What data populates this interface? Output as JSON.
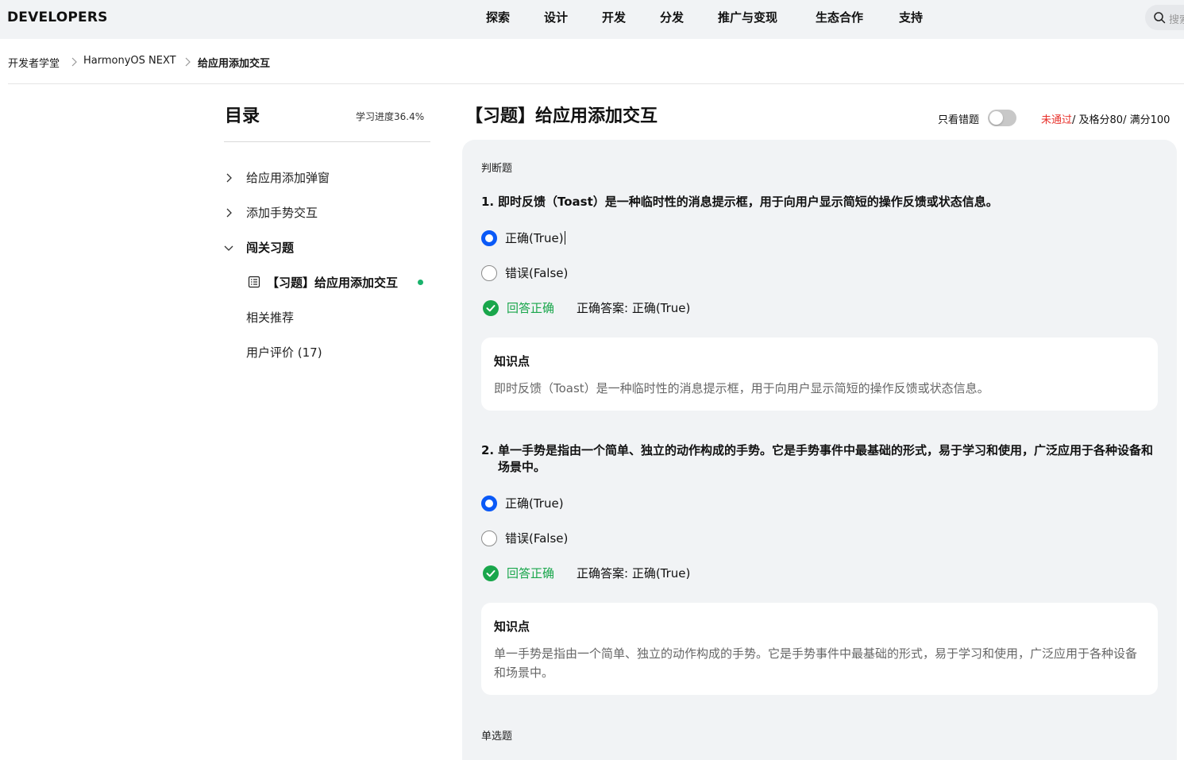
{
  "brand": "DEVELOPERS",
  "nav": {
    "items": [
      {
        "label": "探索"
      },
      {
        "label": "设计"
      },
      {
        "label": "开发"
      },
      {
        "label": "分发"
      },
      {
        "label": "推广与变现"
      },
      {
        "label": "生态合作"
      },
      {
        "label": "支持"
      }
    ],
    "search_placeholder": "搜索"
  },
  "breadcrumb": [
    {
      "label": "开发者学堂"
    },
    {
      "label": "HarmonyOS NEXT"
    },
    {
      "label": "给应用添加交互"
    }
  ],
  "toc": {
    "title": "目录",
    "progress": "学习进度36.4%",
    "items": [
      {
        "label": "给应用添加弹窗"
      },
      {
        "label": "添加手势交互"
      },
      {
        "label": "闯关习题"
      },
      {
        "label": "【习题】给应用添加交互"
      },
      {
        "label": "相关推荐"
      },
      {
        "label": "用户评价 (17)"
      }
    ]
  },
  "main": {
    "title": "【习题】给应用添加交互",
    "wrong_only_label": "只看错题",
    "wrong_only_enabled": false,
    "score": {
      "status": "未通过",
      "rest": "/ 及格分80/ 满分100"
    },
    "sections": [
      {
        "label": "判断题"
      },
      {
        "label": "单选题"
      }
    ],
    "questions": [
      {
        "number": "1.",
        "text": "即时反馈（Toast）是一种临时性的消息提示框，用于向用户显示简短的操作反馈或状态信息。",
        "options": [
          {
            "label": "正确(True)",
            "selected": true
          },
          {
            "label": "错误(False)",
            "selected": false
          }
        ],
        "result_status": "回答正确",
        "correct_answer": "正确答案:  正确(True)",
        "knowledge_title": "知识点",
        "knowledge_text": "即时反馈（Toast）是一种临时性的消息提示框，用于向用户显示简短的操作反馈或状态信息。"
      },
      {
        "number": "2.",
        "text": "单一手势是指由一个简单、独立的动作构成的手势。它是手势事件中最基础的形式，易于学习和使用，广泛应用于各种设备和场景中。",
        "options": [
          {
            "label": "正确(True)",
            "selected": true
          },
          {
            "label": "错误(False)",
            "selected": false
          }
        ],
        "result_status": "回答正确",
        "correct_answer": "正确答案:  正确(True)",
        "knowledge_title": "知识点",
        "knowledge_text": "单一手势是指由一个简单、独立的动作构成的手势。它是手势事件中最基础的形式，易于学习和使用，广泛应用于各种设备和场景中。"
      }
    ]
  },
  "colors": {
    "accent": "#0a59f7",
    "success": "#19a64b",
    "fail": "#e8322c",
    "panel_bg": "#f1f3f5"
  }
}
